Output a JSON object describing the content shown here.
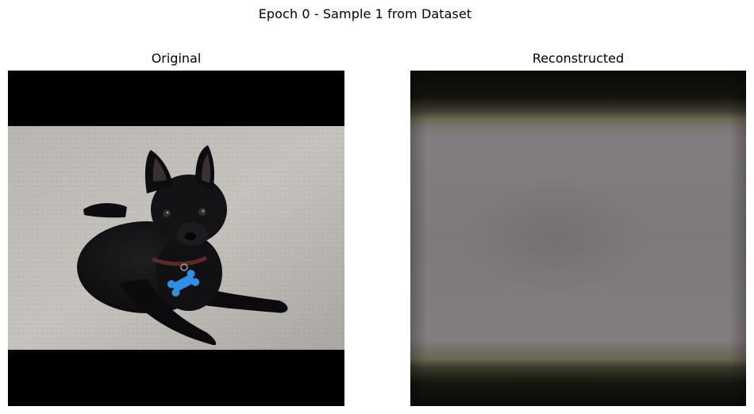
{
  "figure": {
    "suptitle": "Epoch 0 - Sample 1 from Dataset"
  },
  "panels": [
    {
      "title": "Original"
    },
    {
      "title": "Reconstructed"
    }
  ]
}
